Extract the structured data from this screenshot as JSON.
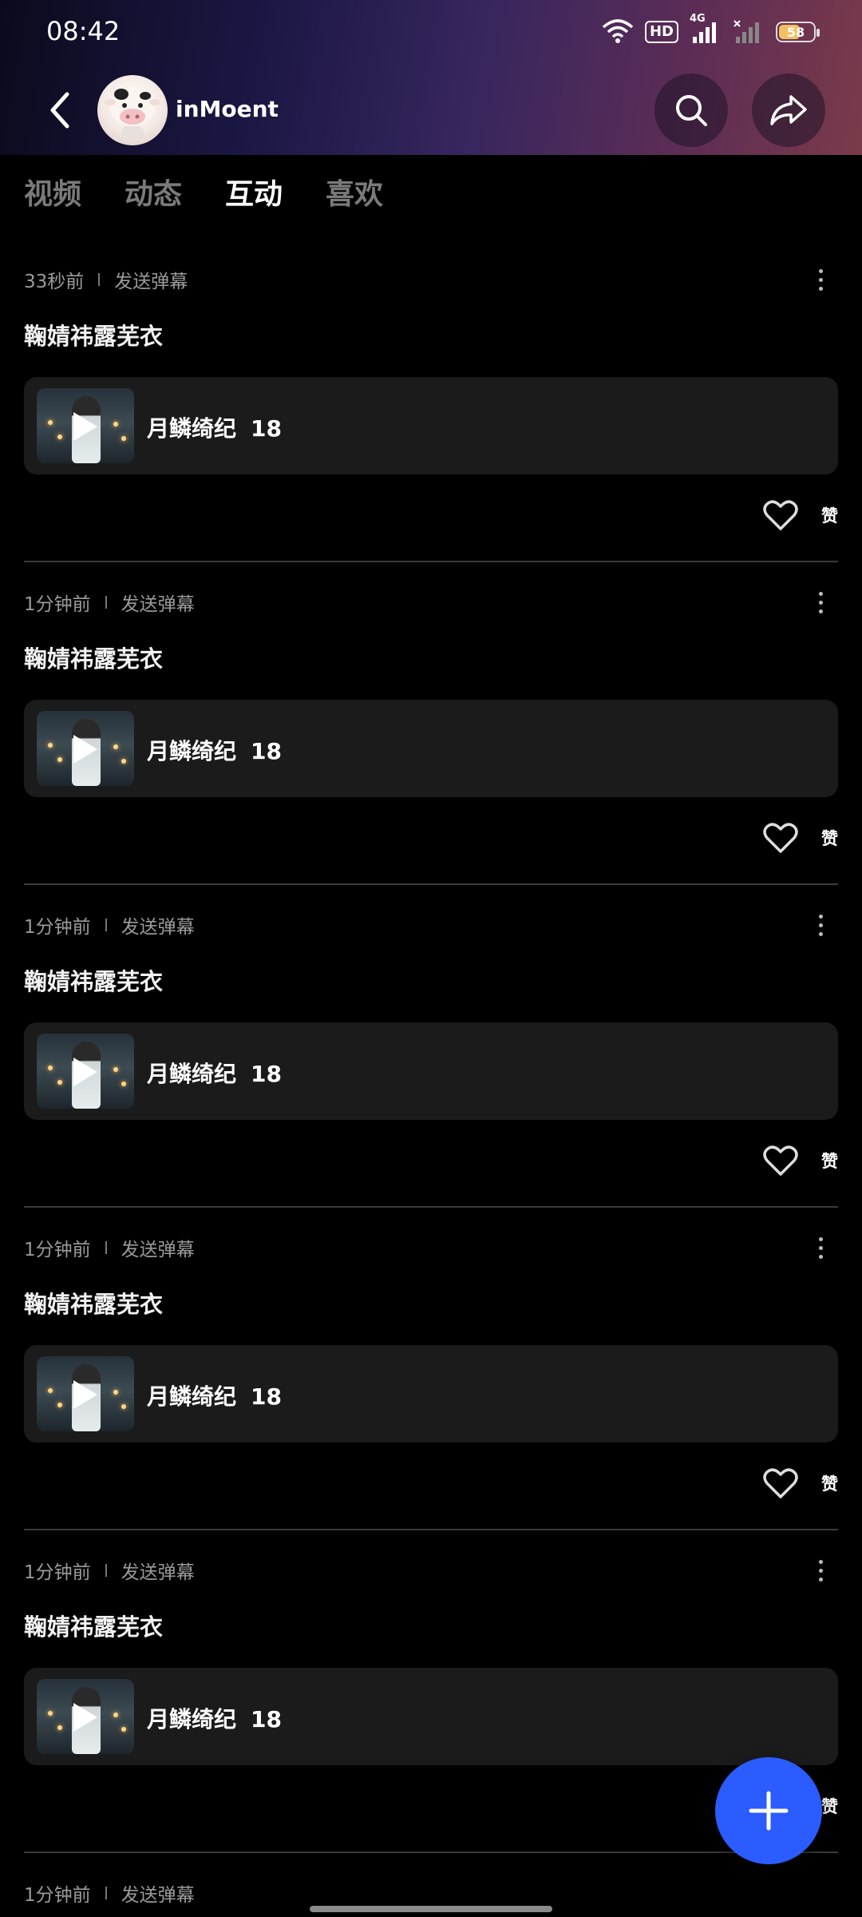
{
  "status_bar": {
    "time": "08:42",
    "hd_label": "HD",
    "network_label": "4G",
    "battery": "58"
  },
  "header": {
    "username": "inMoent"
  },
  "tabs": [
    {
      "label": "视频",
      "active": false
    },
    {
      "label": "动态",
      "active": false
    },
    {
      "label": "互动",
      "active": true
    },
    {
      "label": "喜欢",
      "active": false
    }
  ],
  "posts": [
    {
      "time": "33秒前",
      "action": "发送弹幕",
      "text": "鞠婧祎露芜衣",
      "video_title": "月鳞绮纪",
      "video_episode": "18",
      "like_label": "赞"
    },
    {
      "time": "1分钟前",
      "action": "发送弹幕",
      "text": "鞠婧祎露芜衣",
      "video_title": "月鳞绮纪",
      "video_episode": "18",
      "like_label": "赞"
    },
    {
      "time": "1分钟前",
      "action": "发送弹幕",
      "text": "鞠婧祎露芜衣",
      "video_title": "月鳞绮纪",
      "video_episode": "18",
      "like_label": "赞"
    },
    {
      "time": "1分钟前",
      "action": "发送弹幕",
      "text": "鞠婧祎露芜衣",
      "video_title": "月鳞绮纪",
      "video_episode": "18",
      "like_label": "赞"
    },
    {
      "time": "1分钟前",
      "action": "发送弹幕",
      "text": "鞠婧祎露芜衣",
      "video_title": "月鳞绮纪",
      "video_episode": "18",
      "like_label": "赞"
    },
    {
      "time": "1分钟前",
      "action": "发送弹幕"
    }
  ],
  "icons": {
    "back": "back-arrow-icon",
    "search": "search-icon",
    "share": "share-icon",
    "more": "more-vertical-icon",
    "like": "heart-icon",
    "fab": "plus-icon"
  },
  "colors": {
    "fab": "#2b5cff",
    "tab_active": "#ffffff",
    "tab_inactive": "#7a7a7a",
    "card_bg": "#1b1b1b"
  }
}
